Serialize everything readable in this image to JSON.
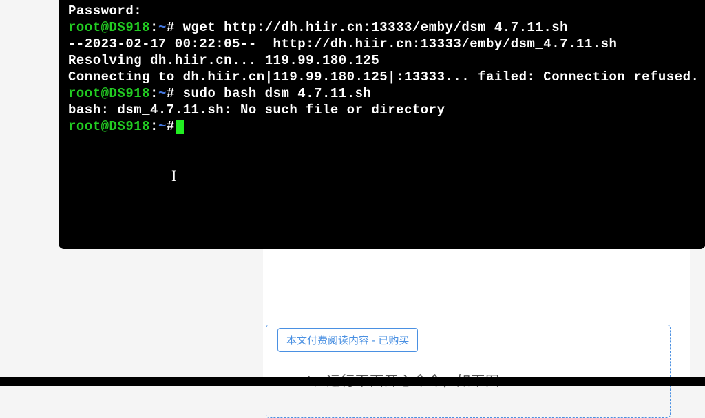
{
  "terminal": {
    "lines": [
      {
        "type": "text",
        "content": "Password:"
      },
      {
        "type": "prompt",
        "user": "root@DS918",
        "path": "~",
        "sep": "#",
        "command": " wget http://dh.hiir.cn:13333/emby/dsm_4.7.11.sh"
      },
      {
        "type": "text",
        "content": "--2023-02-17 00:22:05--  http://dh.hiir.cn:13333/emby/dsm_4.7.11.sh"
      },
      {
        "type": "text",
        "content": "Resolving dh.hiir.cn... 119.99.180.125"
      },
      {
        "type": "text",
        "content": "Connecting to dh.hiir.cn|119.99.180.125|:13333... failed: Connection refused."
      },
      {
        "type": "prompt",
        "user": "root@DS918",
        "path": "~",
        "sep": "#",
        "command": " sudo bash dsm_4.7.11.sh"
      },
      {
        "type": "text",
        "content": "bash: dsm_4.7.11.sh: No such file or directory"
      },
      {
        "type": "prompt",
        "user": "root@DS918",
        "path": "~",
        "sep": "#",
        "command": "",
        "cursor": true
      }
    ]
  },
  "page": {
    "purchase_label": "本文付费阅读内容 - 已购买",
    "article_step": "4、运行下面开心命令，如下图："
  }
}
